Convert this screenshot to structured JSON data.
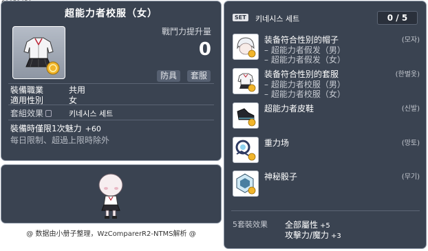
{
  "item_id": "01051450",
  "tooltip": {
    "title": "超能力者校服（女）",
    "power_label": "戰鬥力提升量",
    "power_value": "0",
    "tags": [
      "防具",
      "套服"
    ],
    "stats": [
      {
        "label": "裝備職業",
        "value": "共用"
      },
      {
        "label": "適用性別",
        "value": "女"
      }
    ],
    "set_effect_label": "套組效果",
    "set_effect_name": "키네시스 세트",
    "equip_limit": "裝備時僅限1次魅力",
    "equip_limit_bonus": "+60",
    "limit_note": "每日限制、超過上限時除外"
  },
  "footer_note": "@ 数据由小册子整理，WzComparerR2-NTMS解析 @",
  "set_panel": {
    "badge": "SET",
    "title": "키네시스 세트",
    "count": "0 / 5",
    "items": [
      {
        "name": "装备符合性别的帽子",
        "subs": [
          "– 超能力者假发（男）",
          "– 超能力者假发（女）"
        ],
        "type": "(모자)",
        "icon": "wig-icon"
      },
      {
        "name": "装备符合性别的套服",
        "subs": [
          "– 超能力者校服（男）",
          "– 超能力者校服（女）"
        ],
        "type": "(한벌옷)",
        "icon": "uniform-icon"
      },
      {
        "name": "超能力者皮鞋",
        "subs": [],
        "type": "(신발)",
        "icon": "shoes-icon"
      },
      {
        "name": "重力场",
        "subs": [],
        "type": "(망토)",
        "icon": "cape-icon"
      },
      {
        "name": "神秘骰子",
        "subs": [],
        "type": "(무기)",
        "icon": "dice-icon"
      }
    ],
    "effect_label": "5套裝效果",
    "effects": [
      {
        "text": "全部屬性",
        "value": "+5"
      },
      {
        "text": "攻擊力/魔力",
        "value": "+3"
      }
    ]
  },
  "colors": {
    "panel_bg": "#3a4351",
    "panel_border": "#8d97a6",
    "coin": "#f1b52b"
  }
}
